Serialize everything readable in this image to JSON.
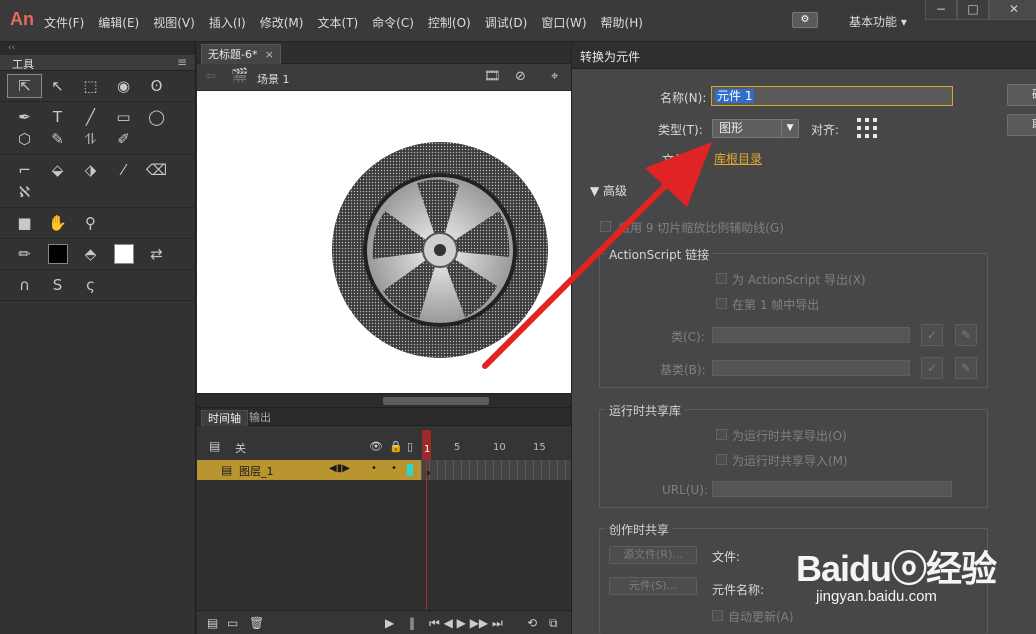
{
  "app": {
    "logo": "An",
    "menu": [
      "文件(F)",
      "编辑(E)",
      "视图(V)",
      "插入(I)",
      "修改(M)",
      "文本(T)",
      "命令(C)",
      "控制(O)",
      "调试(D)",
      "窗口(W)",
      "帮助(H)"
    ],
    "workspace": "基本功能",
    "window_controls": [
      "−",
      "□",
      "✕"
    ]
  },
  "tools": {
    "title": "工具",
    "collapse": "‹‹",
    "rows": [
      [
        "selection-arrow",
        "subselection-arrow",
        "free-transform",
        "3d-rotation",
        "lasso"
      ],
      [
        "pen",
        "text",
        "line",
        "rectangle",
        "oval",
        "polystar",
        "pencil",
        "brush",
        "paint-brush"
      ],
      [
        "bone",
        "paint-bucket",
        "ink-bottle",
        "eyedropper",
        "eraser",
        "width"
      ],
      [
        "camera",
        "hand",
        "zoom"
      ],
      [
        "stroke-color",
        "fill-color",
        "swap-colors"
      ],
      [
        "snap-magnet",
        "smooth",
        "straighten"
      ]
    ],
    "glyphs": [
      "⇱",
      "↖",
      "⬚",
      "◉",
      "ʘ",
      "✒",
      "T",
      "╱",
      "▭",
      "◯",
      "⬡",
      "✎",
      "⥮",
      "✐",
      "⌐",
      "⬙",
      "⬗",
      "⁄",
      "⌫",
      "ℵ",
      "■",
      "✋",
      "⚲",
      "✏",
      "■",
      "⬘",
      "◎",
      "⇄",
      "∩",
      "S",
      "ς"
    ]
  },
  "document": {
    "tab_label": "无标题-6*",
    "tab_close": "×",
    "back": "⇦",
    "scene": "场景 1"
  },
  "timeline": {
    "tabs": [
      "时间轴",
      "输出"
    ],
    "scene_label": "关",
    "ruler": [
      "5",
      "10",
      "15"
    ],
    "playhead_frame": "1",
    "layer_name": "图层_1"
  },
  "dialog": {
    "title": "转换为元件",
    "name_label": "名称(N):",
    "name_value": "元件 1",
    "type_label": "类型(T):",
    "type_value": "图形",
    "align_label": "对齐:",
    "folder_label": "文件",
    "folder_value": "库根目录",
    "buttons": [
      "确",
      "取"
    ],
    "advanced": "高级",
    "nine_slice": "启用 9 切片缩放比例辅助线(G)",
    "as_group": "ActionScript 链接",
    "as_export": "为 ActionScript 导出(X)",
    "as_frame1": "在第 1 帧中导出",
    "class_label": "类(C):",
    "base_class_label": "基类(B):",
    "runtime_group": "运行时共享库",
    "runtime_export": "为运行时共享导出(O)",
    "runtime_import": "为运行时共享导入(M)",
    "url_label": "URL(U):",
    "authoring_group": "创作时共享",
    "source_file_btn": "源文件(R)...",
    "file_label": "文件:",
    "symbol_btn": "元件(S)...",
    "symbol_name_label": "元件名称:",
    "auto_update": "自动更新(A)"
  },
  "watermark": {
    "main": "Baiduⓞ经验",
    "sub": "jingyan.baidu.com"
  },
  "colors": {
    "accent_orange": "#d9a521",
    "arrow_red": "#e02424",
    "layer_highlight": "#b8952e",
    "playhead": "#b02828"
  }
}
